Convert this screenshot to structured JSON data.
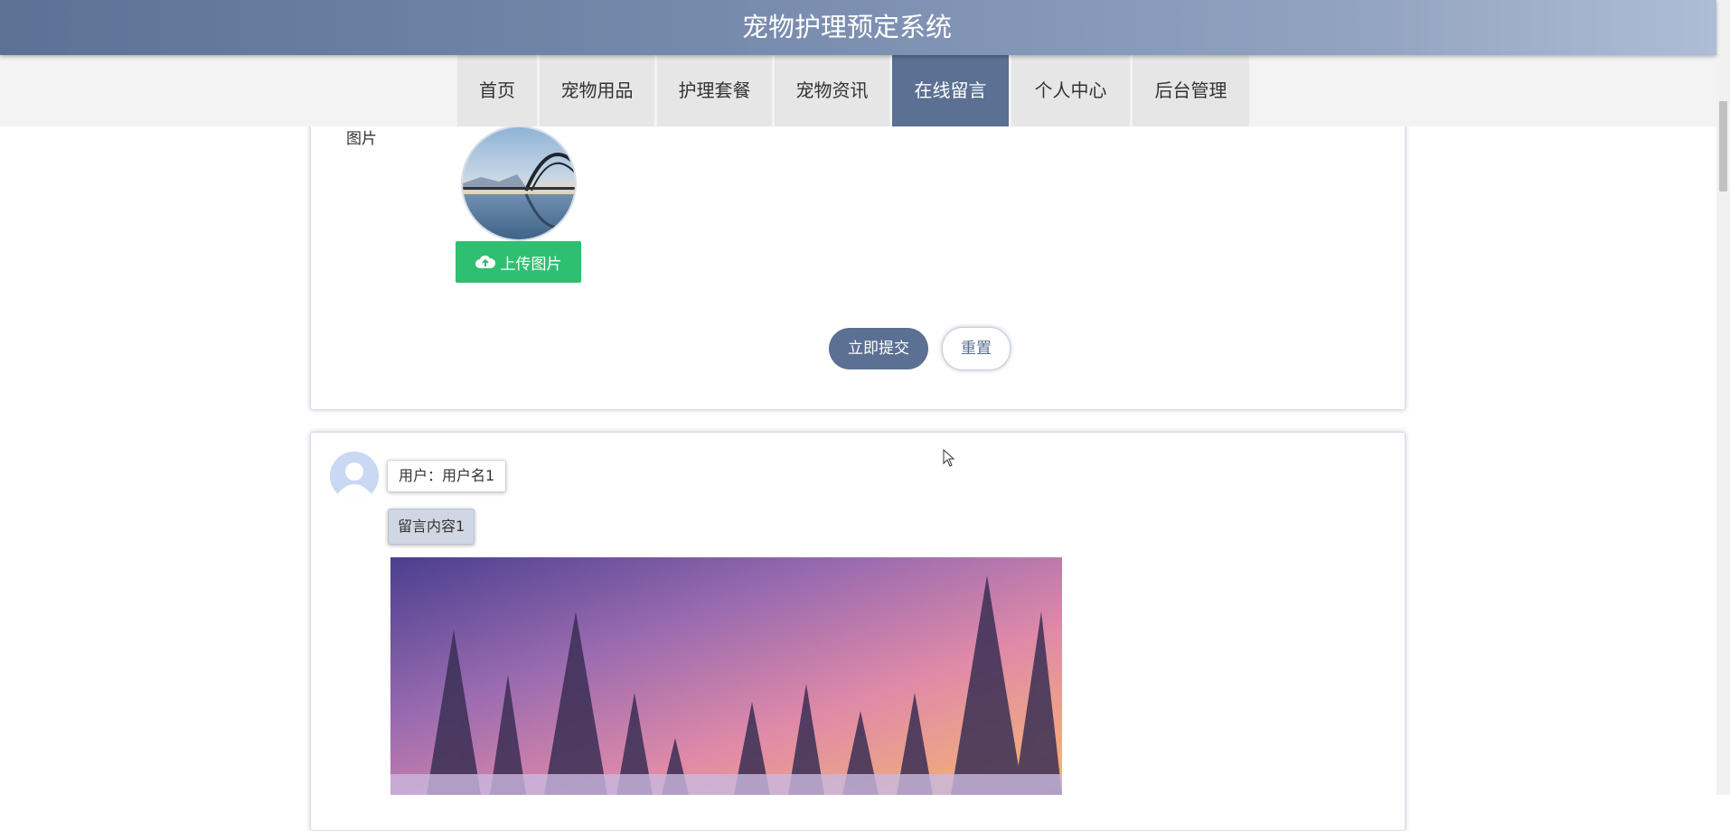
{
  "header": {
    "title": "宠物护理预定系统"
  },
  "nav": {
    "items": [
      {
        "label": "首页",
        "name": "nav-home",
        "active": false
      },
      {
        "label": "宠物用品",
        "name": "nav-pet-supplies",
        "active": false
      },
      {
        "label": "护理套餐",
        "name": "nav-care-packages",
        "active": false
      },
      {
        "label": "宠物资讯",
        "name": "nav-pet-news",
        "active": false
      },
      {
        "label": "在线留言",
        "name": "nav-online-message",
        "active": true
      },
      {
        "label": "个人中心",
        "name": "nav-personal-center",
        "active": false
      },
      {
        "label": "后台管理",
        "name": "nav-admin",
        "active": false
      }
    ]
  },
  "form": {
    "image_label": "图片",
    "upload_label": "上传图片",
    "submit_label": "立即提交",
    "reset_label": "重置"
  },
  "messages": [
    {
      "user": "用户：用户名1",
      "content": "留言内容1"
    }
  ],
  "colors": {
    "primary": "#5b7092",
    "upload": "#2fbf71",
    "nav_bg": "#e6e6e7"
  }
}
